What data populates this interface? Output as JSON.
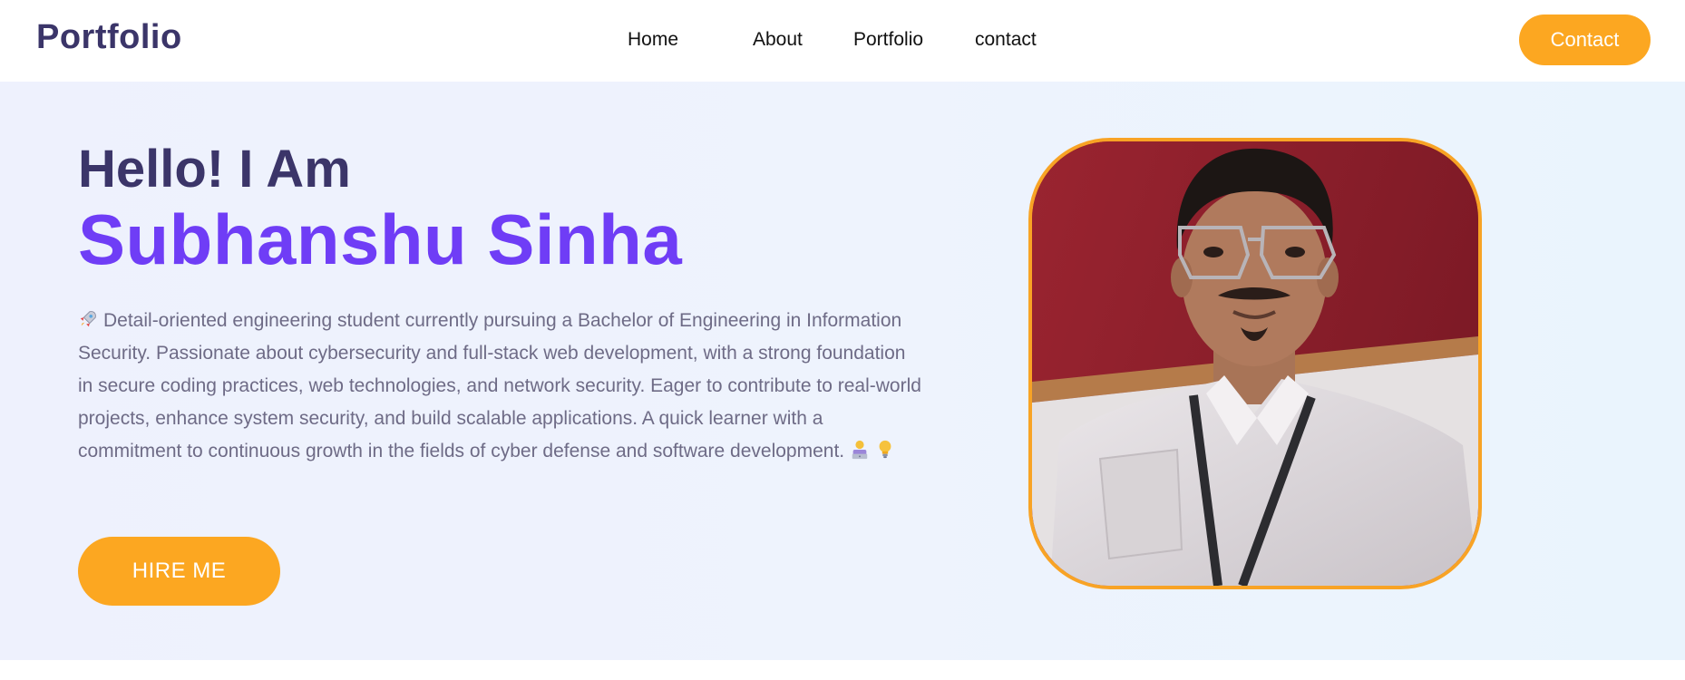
{
  "header": {
    "logo": "Portfolio",
    "nav": [
      {
        "label": "Home"
      },
      {
        "label": "About"
      },
      {
        "label": "Portfolio"
      },
      {
        "label": "contact"
      }
    ],
    "contact_button": "Contact"
  },
  "hero": {
    "greeting": "Hello! I Am",
    "name": "Subhanshu Sinha",
    "bio": "Detail-oriented engineering student currently pursuing a Bachelor of Engineering in Information Security. Passionate about cybersecurity and full-stack web development, with a strong foundation in secure coding practices, web technologies, and network security. Eager to contribute to real-world projects, enhance system security, and build scalable applications. A quick learner with a commitment to continuous growth in the fields of cyber defense and software development.",
    "bio_icons": [
      "rocket-icon",
      "technologist-icon",
      "lightbulb-icon"
    ],
    "hire_button": "HIRE ME"
  },
  "colors": {
    "accent": "#fca721",
    "brand_dark": "#3b3569",
    "name_purple": "#6f3df6",
    "body_text": "#6e6b86",
    "photo_border": "#f8a325"
  }
}
